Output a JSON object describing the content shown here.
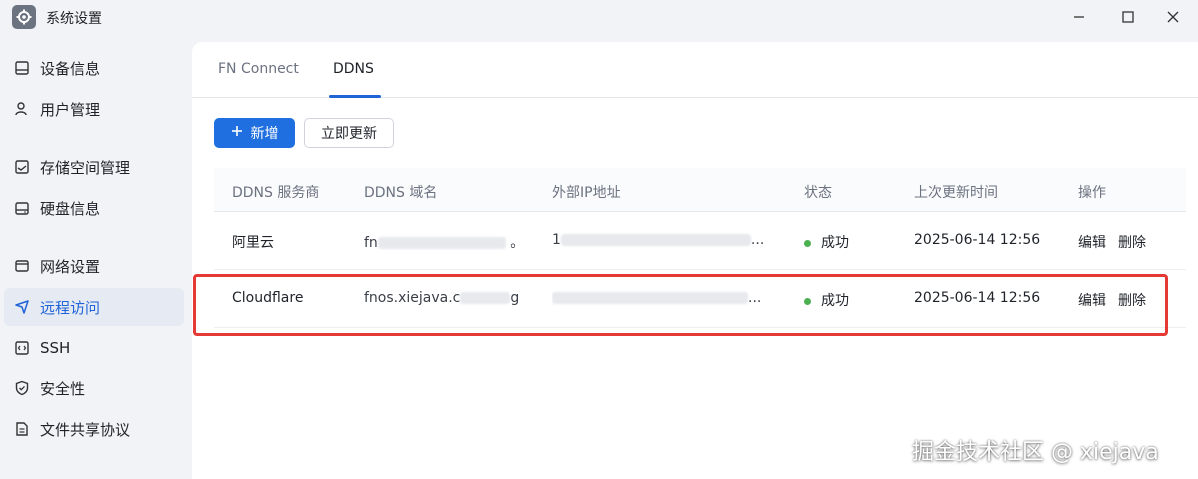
{
  "window": {
    "title": "系统设置",
    "icon": "gear-icon",
    "controls": [
      "minimize-icon",
      "maximize-icon",
      "close-icon"
    ]
  },
  "sidebar": {
    "items": [
      {
        "label": "设备信息",
        "icon": "device-icon"
      },
      {
        "label": "用户管理",
        "icon": "user-icon"
      },
      {
        "label": "存储空间管理",
        "icon": "storage-icon"
      },
      {
        "label": "硬盘信息",
        "icon": "disk-icon"
      },
      {
        "label": "网络设置",
        "icon": "network-icon"
      },
      {
        "label": "远程访问",
        "icon": "send-icon",
        "active": true
      },
      {
        "label": "SSH",
        "icon": "code-icon"
      },
      {
        "label": "安全性",
        "icon": "shield-icon"
      },
      {
        "label": "文件共享协议",
        "icon": "document-icon"
      }
    ]
  },
  "tabs": [
    {
      "label": "FN Connect",
      "active": false
    },
    {
      "label": "DDNS",
      "active": true
    }
  ],
  "toolbar": {
    "add_label": "新增",
    "add_icon": "plus-icon",
    "update_label": "立即更新"
  },
  "table": {
    "headers": [
      "DDNS 服务商",
      "DDNS 域名",
      "外部IP地址",
      "状态",
      "上次更新时间",
      "操作"
    ],
    "rows": [
      {
        "provider": "阿里云",
        "domain": "fn",
        "domain_suffix": "。",
        "ip": "1",
        "ip_suffix": "...",
        "status": "成功",
        "updated": "2025-06-14 12:56",
        "edit": "编辑",
        "delete": "删除"
      },
      {
        "provider": "Cloudflare",
        "domain": "fnos.xiejava.c",
        "domain_suffix": "g",
        "ip": "",
        "ip_suffix": "...",
        "status": "成功",
        "updated": "2025-06-14 12:56",
        "edit": "编辑",
        "delete": "删除"
      }
    ]
  },
  "colors": {
    "accent": "#1f6fe0",
    "success": "#4caf50",
    "highlight": "#e53935"
  },
  "watermark": "掘金技术社区 @ xiejava"
}
